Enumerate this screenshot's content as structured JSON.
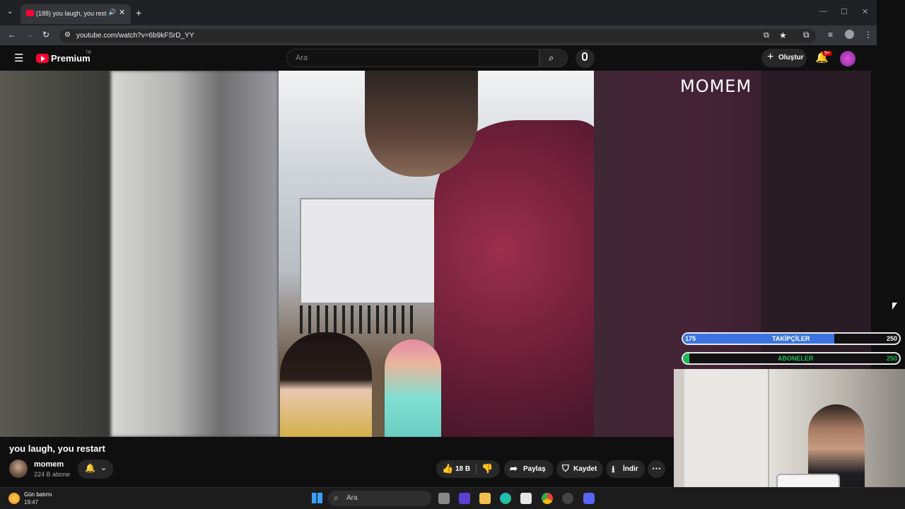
{
  "browser": {
    "tab_title": "(188) you laugh, you restart",
    "url": "youtube.com/watch?v=6b9kFSrD_YY"
  },
  "youtube": {
    "logo_text": "Premium",
    "logo_region": "TR",
    "search_placeholder": "Ara",
    "create_label": "Oluştur",
    "notification_count": "9+"
  },
  "video": {
    "watermark": "MOMEM",
    "title": "you laugh, you restart",
    "channel_name": "momem",
    "subscribers": "224 B abone",
    "likes": "18 B",
    "share_label": "Paylaş",
    "save_label": "Kaydet",
    "download_label": "İndir"
  },
  "overlay": {
    "followers": {
      "current": "175",
      "label": "TAKİPÇİLER",
      "goal": "250",
      "progress": 0.7
    },
    "subscribers": {
      "current": "7",
      "label": "ABONELER",
      "goal": "250",
      "progress": 0.03
    },
    "colors": {
      "followers_fill": "#3b74e0",
      "subscribers_fill": "#1db954"
    }
  },
  "taskbar": {
    "weather_title": "Gün batımı",
    "weather_time": "19:47",
    "search_label": "Ara"
  },
  "colors": {
    "youtube_red": "#ff0033",
    "background": "#0f0f0f"
  }
}
